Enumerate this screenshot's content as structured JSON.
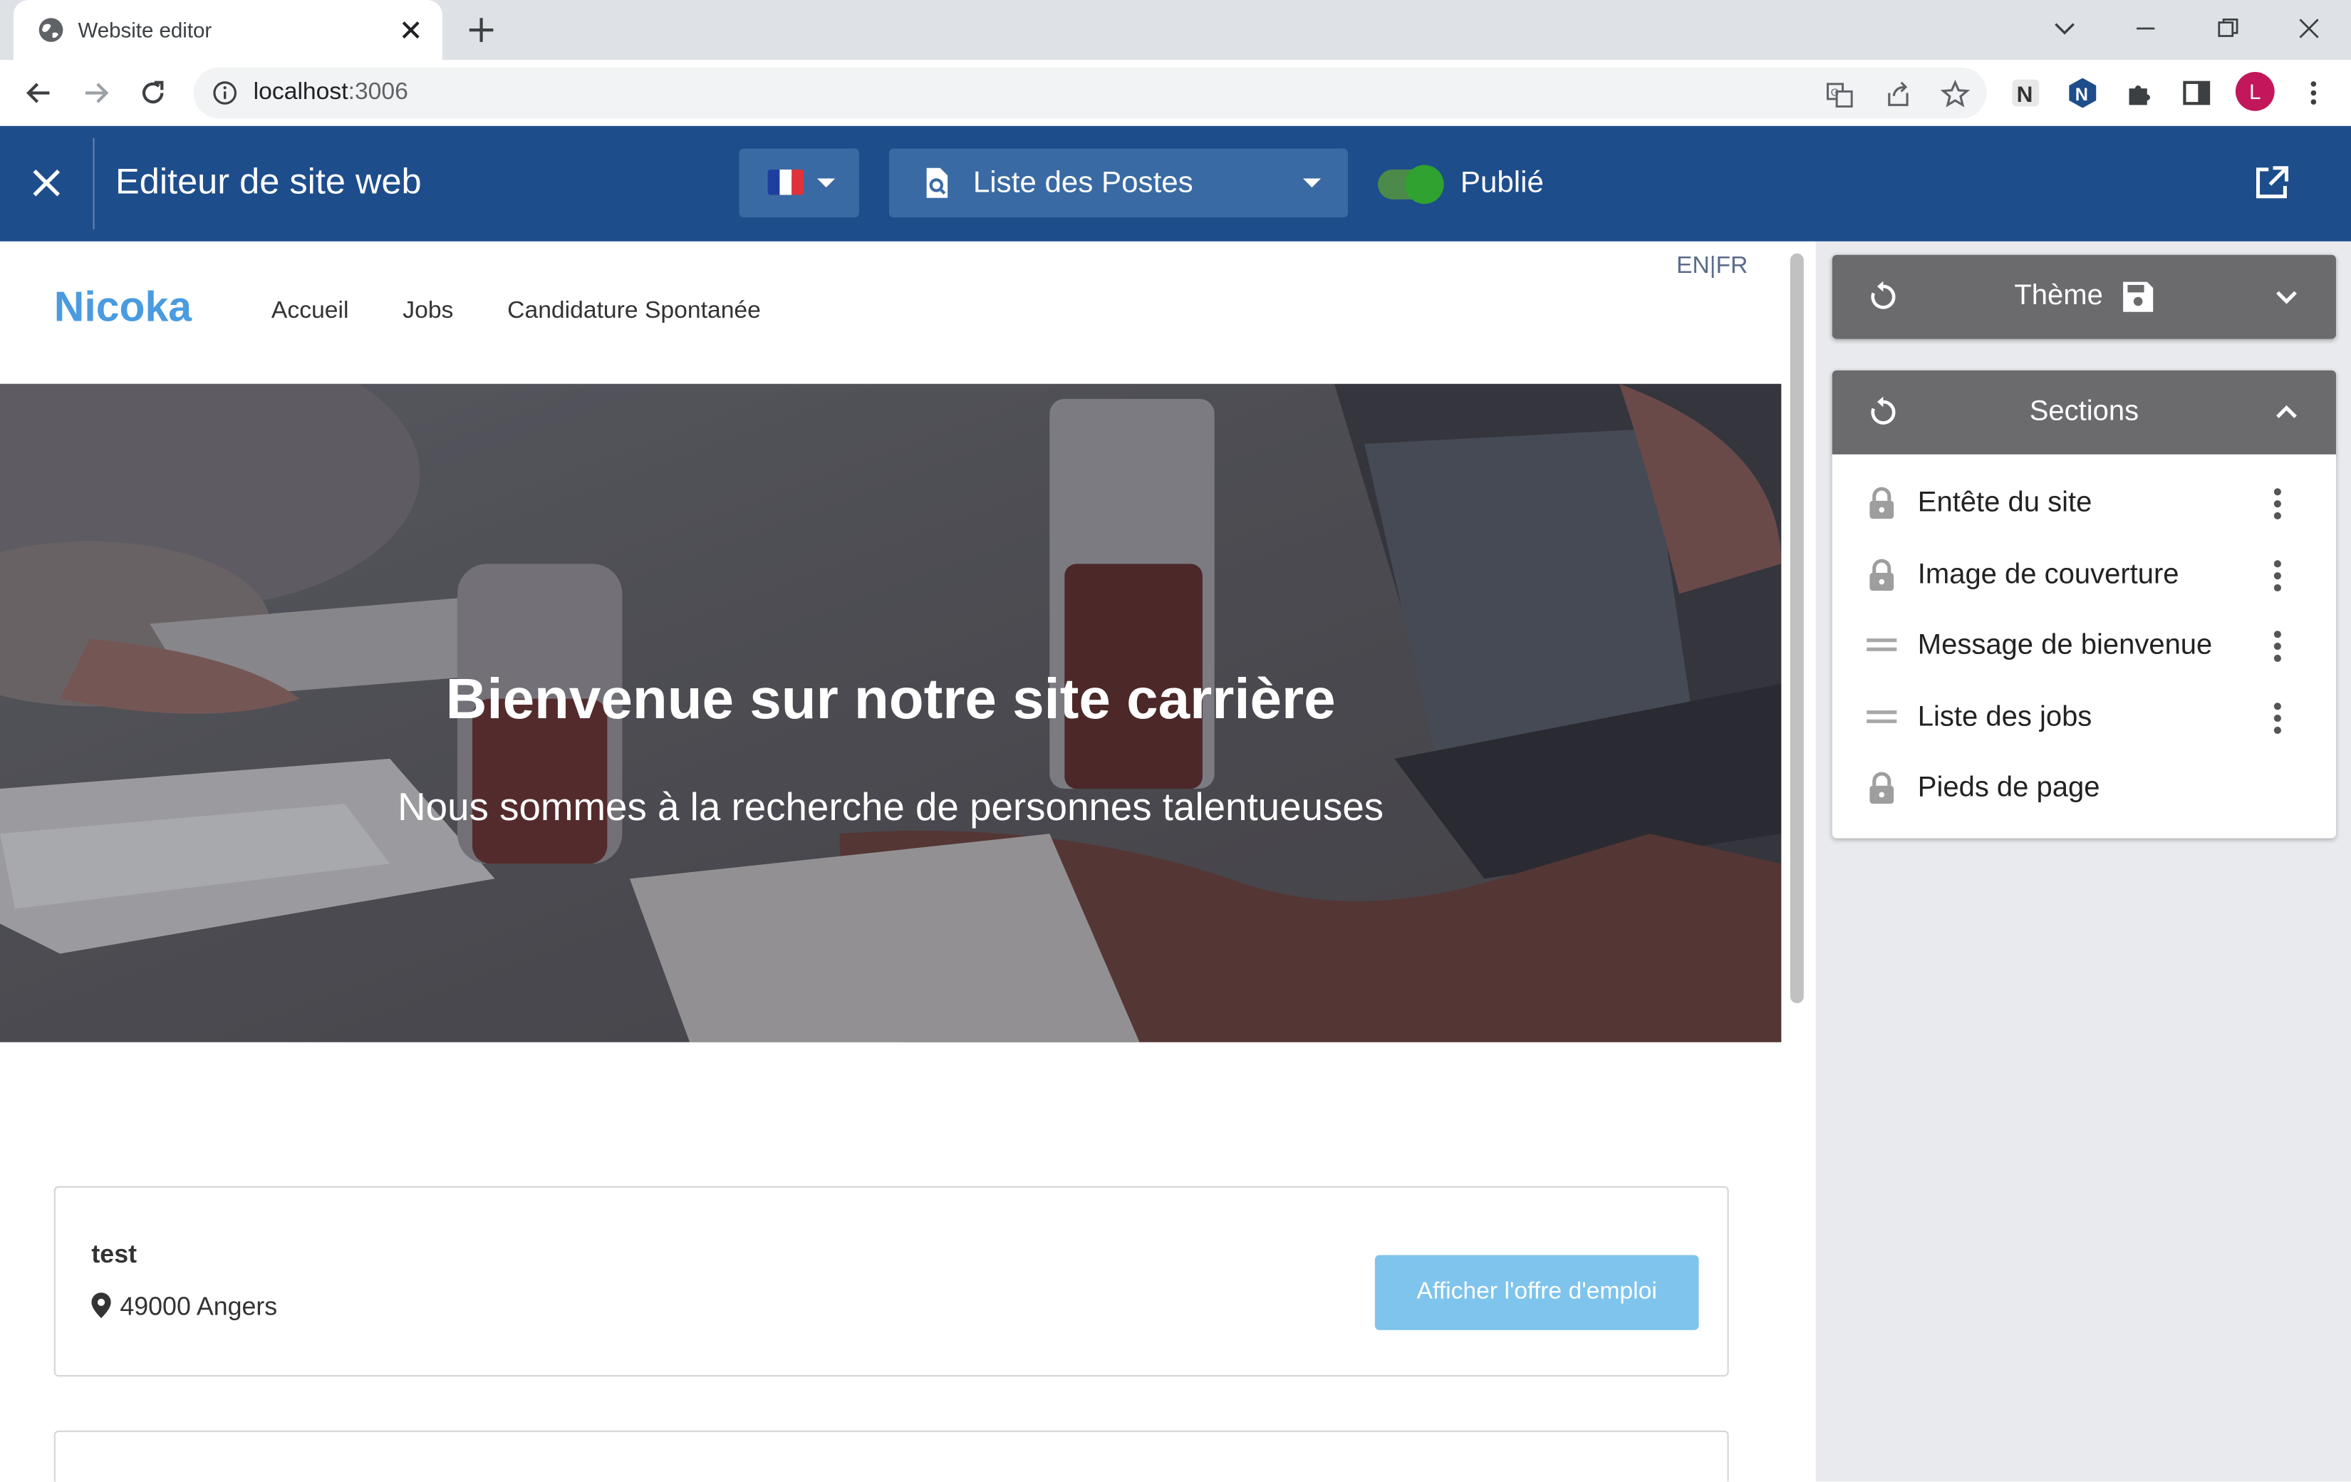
{
  "browser": {
    "tab_title": "Website editor",
    "url_host": "localhost",
    "url_port": ":3006",
    "profile_initial": "L"
  },
  "app": {
    "title": "Editeur de site web",
    "language_flag": "fr-flag",
    "page_select": "Liste des Postes",
    "published_label": "Publié",
    "published": true
  },
  "site": {
    "lang_links": "EN|FR",
    "brand": "Nicoka",
    "nav": [
      "Accueil",
      "Jobs",
      "Candidature Spontanée"
    ],
    "hero_title": "Bienvenue sur notre site carrière",
    "hero_subtitle": "Nous sommes à la recherche de personnes talentueuses",
    "jobs": [
      {
        "title": "test",
        "location": "49000 Angers",
        "button": "Afficher l'offre d'emploi"
      }
    ]
  },
  "panel": {
    "theme_label": "Thème",
    "sections_label": "Sections",
    "sections": [
      {
        "label": "Entête du site",
        "icon": "lock-icon",
        "menu": true
      },
      {
        "label": "Image de couverture",
        "icon": "lock-icon",
        "menu": true
      },
      {
        "label": "Message de bienvenue",
        "icon": "drag-handle-icon",
        "menu": true
      },
      {
        "label": "Liste des jobs",
        "icon": "drag-handle-icon",
        "menu": true
      },
      {
        "label": "Pieds de page",
        "icon": "lock-icon",
        "menu": false
      }
    ]
  },
  "colors": {
    "appbar": "#1e4d8c",
    "brand": "#4a9be0",
    "job_button": "#7ec4ec",
    "panel_header": "#6b6b6e",
    "toggle_on": "#2fa22f"
  }
}
